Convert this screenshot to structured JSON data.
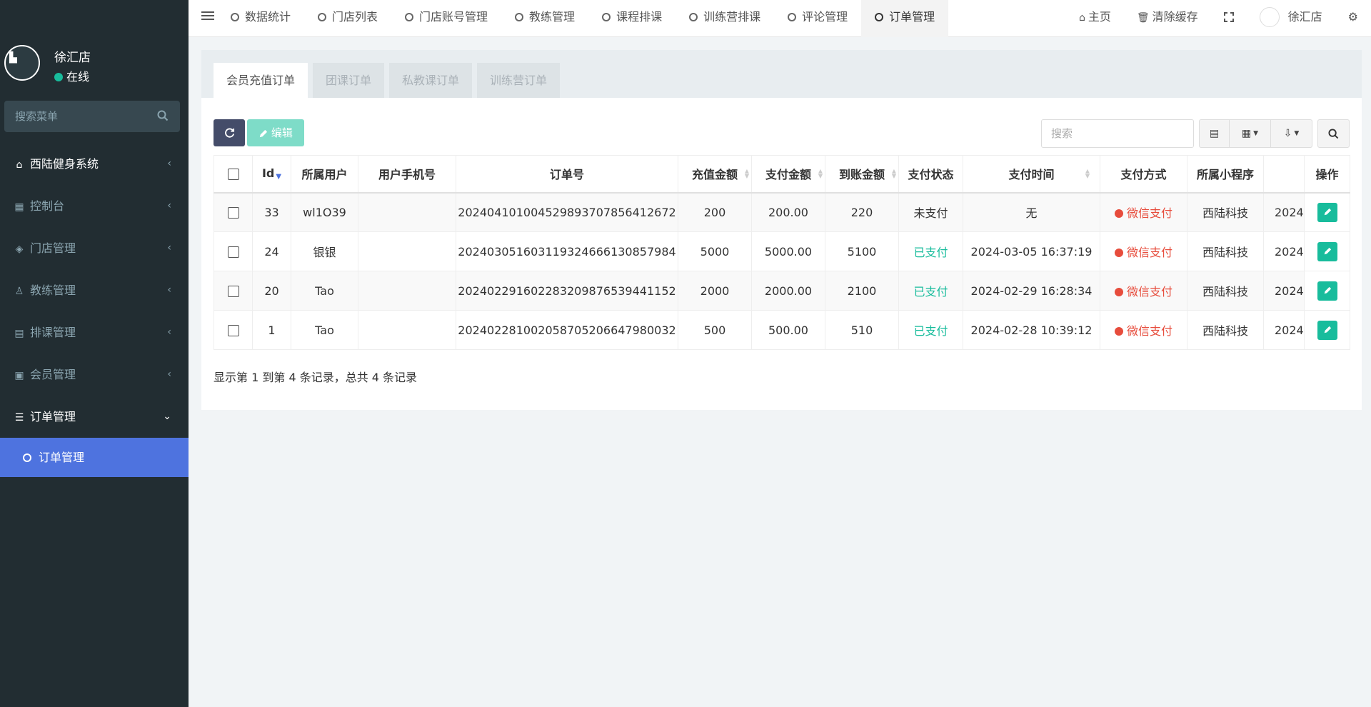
{
  "sidebar": {
    "user_name": "徐汇店",
    "user_status": "在线",
    "search_placeholder": "搜索菜单",
    "menu": [
      {
        "label": "西陆健身系统",
        "icon": "store-icon"
      },
      {
        "label": "控制台",
        "icon": "windows-icon"
      },
      {
        "label": "门店管理",
        "icon": "puzzle-icon"
      },
      {
        "label": "教练管理",
        "icon": "coach-icon"
      },
      {
        "label": "排课管理",
        "icon": "calendar-icon"
      },
      {
        "label": "会员管理",
        "icon": "id-card-icon"
      },
      {
        "label": "订单管理",
        "icon": "database-icon"
      }
    ],
    "submenu_active": "订单管理"
  },
  "topnav": {
    "tabs": [
      "数据统计",
      "门店列表",
      "门店账号管理",
      "教练管理",
      "课程排课",
      "训练营排课",
      "评论管理",
      "订单管理"
    ],
    "active_tab": "订单管理",
    "home": "主页",
    "clear_cache": "清除缓存",
    "user_name": "徐汇店"
  },
  "panel": {
    "tabs": [
      "会员充值订单",
      "团课订单",
      "私教课订单",
      "训练营订单"
    ],
    "active_tab": "会员充值订单",
    "edit_label": "编辑",
    "search_placeholder": "搜索",
    "footer": "显示第 1 到第 4 条记录，总共 4 条记录"
  },
  "table": {
    "headers": [
      "Id",
      "所属用户",
      "用户手机号",
      "订单号",
      "充值金额",
      "支付金额",
      "到账金额",
      "支付状态",
      "支付时间",
      "支付方式",
      "所属小程序",
      "",
      "操作"
    ],
    "rows": [
      {
        "id": "33",
        "user": "wl1O39",
        "phone": "",
        "order_no": "20240410100452989370785641267​2",
        "recharge": "200",
        "paid": "200.00",
        "credited": "220",
        "status": "未支付",
        "status_kind": "unpaid",
        "pay_time": "无",
        "pay_method": "微信支付",
        "app": "西陆科技",
        "extra": "2024"
      },
      {
        "id": "24",
        "user": "银银",
        "phone": "",
        "order_no": "202403051603119324666130857984",
        "recharge": "5000",
        "paid": "5000.00",
        "credited": "5100",
        "status": "已支付",
        "status_kind": "paid",
        "pay_time": "2024-03-05 16:37:19",
        "pay_method": "微信支付",
        "app": "西陆科技",
        "extra": "2024"
      },
      {
        "id": "20",
        "user": "Tao",
        "phone": "",
        "order_no": "202402291602283209876539441152",
        "recharge": "2000",
        "paid": "2000.00",
        "credited": "2100",
        "status": "已支付",
        "status_kind": "paid",
        "pay_time": "2024-02-29 16:28:34",
        "pay_method": "微信支付",
        "app": "西陆科技",
        "extra": "2024"
      },
      {
        "id": "1",
        "user": "Tao",
        "phone": "",
        "order_no": "202402281002058705206647980032",
        "recharge": "500",
        "paid": "500.00",
        "credited": "510",
        "status": "已支付",
        "status_kind": "paid",
        "pay_time": "2024-02-28 10:39:12",
        "pay_method": "微信支付",
        "app": "西陆科技",
        "extra": "2024"
      }
    ]
  },
  "colors": {
    "sidebar_bg": "#222d32",
    "active_menu": "#4e73df",
    "paid_green": "#18bc9c",
    "wechat_red": "#e74c3c",
    "refresh_btn": "#444c69",
    "edit_btn": "#7edcc8"
  }
}
